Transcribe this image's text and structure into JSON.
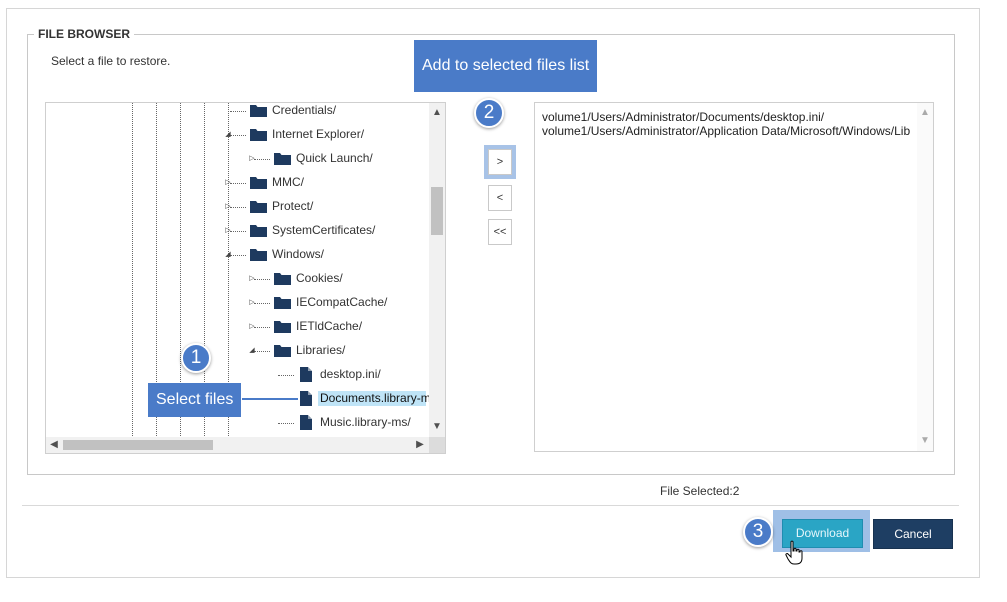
{
  "panel": {
    "legend": "FILE BROWSER",
    "subtitle": "Select a file to restore."
  },
  "tree": {
    "nodes": [
      {
        "label": "Credentials/",
        "type": "folder",
        "toggle": ""
      },
      {
        "label": "Internet Explorer/",
        "type": "folder",
        "toggle": "expanded"
      },
      {
        "label": "Quick Launch/",
        "type": "folder",
        "toggle": "collapsed"
      },
      {
        "label": "MMC/",
        "type": "folder",
        "toggle": "collapsed"
      },
      {
        "label": "Protect/",
        "type": "folder",
        "toggle": "collapsed"
      },
      {
        "label": "SystemCertificates/",
        "type": "folder",
        "toggle": "collapsed"
      },
      {
        "label": "Windows/",
        "type": "folder",
        "toggle": "expanded"
      },
      {
        "label": "Cookies/",
        "type": "folder",
        "toggle": "collapsed"
      },
      {
        "label": "IECompatCache/",
        "type": "folder",
        "toggle": "collapsed"
      },
      {
        "label": "IETldCache/",
        "type": "folder",
        "toggle": "collapsed"
      },
      {
        "label": "Libraries/",
        "type": "folder",
        "toggle": "expanded"
      },
      {
        "label": "desktop.ini/",
        "type": "file",
        "toggle": ""
      },
      {
        "label": "Documents.library-m",
        "type": "file",
        "toggle": "",
        "selected": true
      },
      {
        "label": "Music.library-ms/",
        "type": "file",
        "toggle": ""
      }
    ]
  },
  "transfer": {
    "add": ">",
    "remove": "<",
    "remove_all": "<<"
  },
  "selected_files": [
    "volume1/Users/Administrator/Documents/desktop.ini/",
    "volume1/Users/Administrator/Application Data/Microsoft/Windows/Lib"
  ],
  "file_count": "File Selected:2",
  "buttons": {
    "download": "Download",
    "cancel": "Cancel"
  },
  "callouts": {
    "step1_number": "1",
    "step1_text": "Select files",
    "step2_number": "2",
    "step2_text": "Add to selected files list",
    "step3_number": "3"
  },
  "colors": {
    "callout_blue": "#4a7bc8",
    "download_button": "#2aa5c5",
    "cancel_button": "#1e3e63",
    "selection_highlight": "#bfe4f7",
    "folder_icon": "#1e3a5f"
  },
  "icons": {
    "folder": "folder-icon",
    "file": "file-icon",
    "expanded_toggle": "triangle-down-icon",
    "collapsed_toggle": "triangle-right-icon",
    "cursor": "hand-pointer-icon"
  }
}
